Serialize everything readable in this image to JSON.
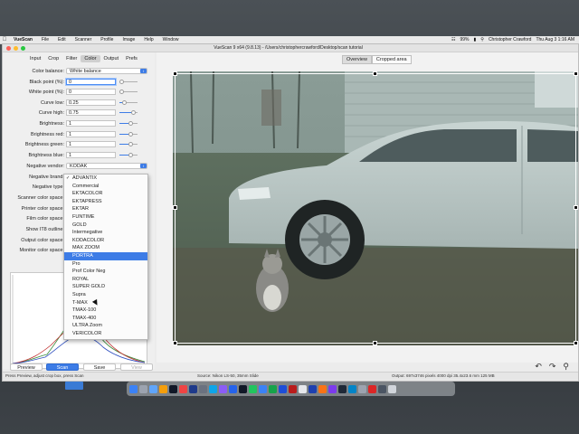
{
  "menubar": {
    "app": "VueScan",
    "items": [
      "File",
      "Edit",
      "Scanner",
      "Profile",
      "Image",
      "Help",
      "Window"
    ],
    "battery": "99%",
    "user": "Christopher Crawford",
    "clock": "Thu Aug 3  1:16 AM"
  },
  "window": {
    "title": "VueScan 9 x64 (9.8.13) - /Users/christophercrawford/Desktop/scan tutorial"
  },
  "tabs": [
    "Input",
    "Crop",
    "Filter",
    "Color",
    "Output",
    "Prefs"
  ],
  "active_tab": "Color",
  "options": {
    "color_balance": {
      "label": "Color balance:",
      "value": "White balance"
    },
    "black_point": {
      "label": "Black point (%):",
      "value": "0"
    },
    "white_point": {
      "label": "White point (%):",
      "value": "0"
    },
    "curve_low": {
      "label": "Curve low:",
      "value": "0.25"
    },
    "curve_high": {
      "label": "Curve high:",
      "value": "0.75"
    },
    "brightness": {
      "label": "Brightness:",
      "value": "1"
    },
    "brightness_red": {
      "label": "Brightness red:",
      "value": "1"
    },
    "brightness_green": {
      "label": "Brightness green:",
      "value": "1"
    },
    "brightness_blue": {
      "label": "Brightness blue:",
      "value": "1"
    },
    "negative_vendor": {
      "label": "Negative vendor:",
      "value": "KODAK"
    },
    "negative_brand": {
      "label": "Negative brand:"
    },
    "negative_type": {
      "label": "Negative type:"
    },
    "scanner_color_space": {
      "label": "Scanner color space:"
    },
    "printer_color_space": {
      "label": "Printer color space:"
    },
    "film_color_space": {
      "label": "Film color space:"
    },
    "show_it8_outline": {
      "label": "Show IT8 outline:"
    },
    "output_color_space": {
      "label": "Output color space:"
    },
    "monitor_color_space": {
      "label": "Monitor color space:"
    }
  },
  "dropdown": {
    "items": [
      "ADVANTIX",
      "Commercial",
      "EKTACOLOR",
      "EKTAPRESS",
      "EKTAR",
      "FUNTIME",
      "GOLD",
      "Intermegative",
      "KODACOLOR",
      "MAX ZOOM",
      "PORTRA",
      "Pro",
      "Prof Color Neg",
      "ROYAL",
      "SUPER GOLD",
      "Supra",
      "T-MAX",
      "TMAX-100",
      "TMAX-400",
      "ULTRA Zoom",
      "VERICOLOR"
    ],
    "checked": "ADVANTIX",
    "highlighted": "PORTRA"
  },
  "buttons": {
    "preview": "Preview",
    "scan": "Scan",
    "save": "Save",
    "view": "View"
  },
  "preview_tabs": {
    "overview": "Overview",
    "cropped": "Cropped area"
  },
  "status": {
    "left": "Press Preview, adjust crop box, press Scan",
    "source": "Source: Nikon LS-50, 35mm Slide",
    "output": "Output: 697x3746 pixels 4000 dpi 35.4x23.6 mm 125 MB"
  },
  "colors": {
    "accent": "#3d7ce6",
    "highlight": "#3d7ce6"
  }
}
